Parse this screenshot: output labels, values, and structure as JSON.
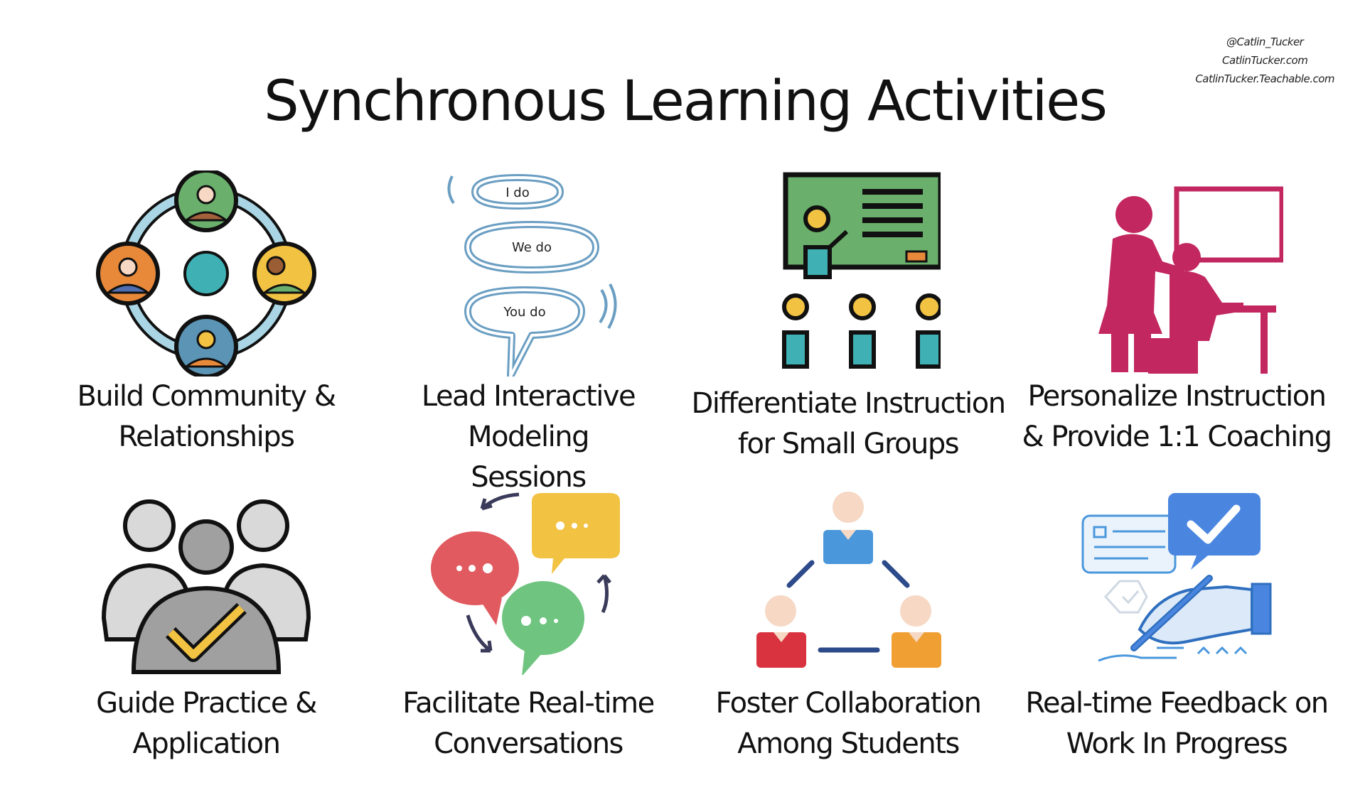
{
  "credits": [
    "@Catlin_Tucker",
    "CatlinTucker.com",
    "CatlinTucker.Teachable.com"
  ],
  "title": "Synchronous Learning Activities",
  "activities": [
    {
      "line1": "Build Community &",
      "line2": "Relationships",
      "icon": "community-circle-icon"
    },
    {
      "line1": "Lead Interactive Modeling",
      "line2": "Sessions",
      "icon": "i-do-we-do-you-do-icon",
      "bubbles": [
        "I do",
        "We do",
        "You do"
      ]
    },
    {
      "line1": "Differentiate Instruction",
      "line2": "for Small Groups",
      "icon": "small-group-teacher-icon"
    },
    {
      "line1": "Personalize Instruction",
      "line2": "& Provide 1:1 Coaching",
      "icon": "one-on-one-coaching-icon"
    },
    {
      "line1": "Guide Practice &",
      "line2": "Application",
      "icon": "group-checkmark-icon"
    },
    {
      "line1": "Facilitate Real-time",
      "line2": "Conversations",
      "icon": "chat-bubbles-icon"
    },
    {
      "line1": "Foster Collaboration",
      "line2": "Among Students",
      "icon": "team-network-icon"
    },
    {
      "line1": "Real-time Feedback on",
      "line2": "Work In Progress",
      "icon": "feedback-writing-icon"
    }
  ],
  "colors": {
    "green": "#6ab06c",
    "orange": "#e8893a",
    "teal": "#3fb1b5",
    "yellow": "#f2c243",
    "blue": "#5b94b5",
    "magenta": "#c2275f",
    "red": "#e05a5f",
    "gray": "#a0a0a0"
  }
}
